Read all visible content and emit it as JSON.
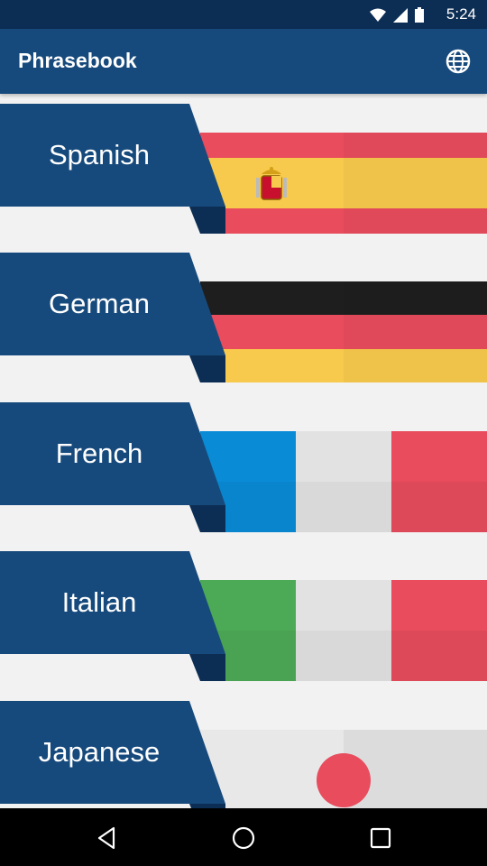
{
  "status_bar": {
    "time": "5:24"
  },
  "app_bar": {
    "title": "Phrasebook",
    "language_icon": "globe-icon"
  },
  "languages": [
    {
      "label": "Spanish",
      "flag": "spain"
    },
    {
      "label": "German",
      "flag": "germany"
    },
    {
      "label": "French",
      "flag": "france"
    },
    {
      "label": "Italian",
      "flag": "italy"
    },
    {
      "label": "Japanese",
      "flag": "japan"
    }
  ],
  "colors": {
    "status_bar": "#0d2e54",
    "app_bar": "#174a7c",
    "banner": "#174a7c",
    "banner_fold": "#0d2e54",
    "spain_red": "#e84c5d",
    "spain_yellow": "#f7c94c",
    "germany_black": "#1e1e1e",
    "germany_red": "#e84c5d",
    "germany_gold": "#f7c94c",
    "france_blue": "#0a8bd6",
    "france_white": "#e2e2e2",
    "france_red": "#e84c5d",
    "italy_green": "#4caa56",
    "italy_white": "#e2e2e2",
    "italy_red": "#e84c5d",
    "japan_white": "#e2e2e2",
    "japan_red": "#e84c5d"
  },
  "nav_bar": {
    "back_icon": "back-icon",
    "home_icon": "home-icon",
    "recents_icon": "recents-icon"
  }
}
